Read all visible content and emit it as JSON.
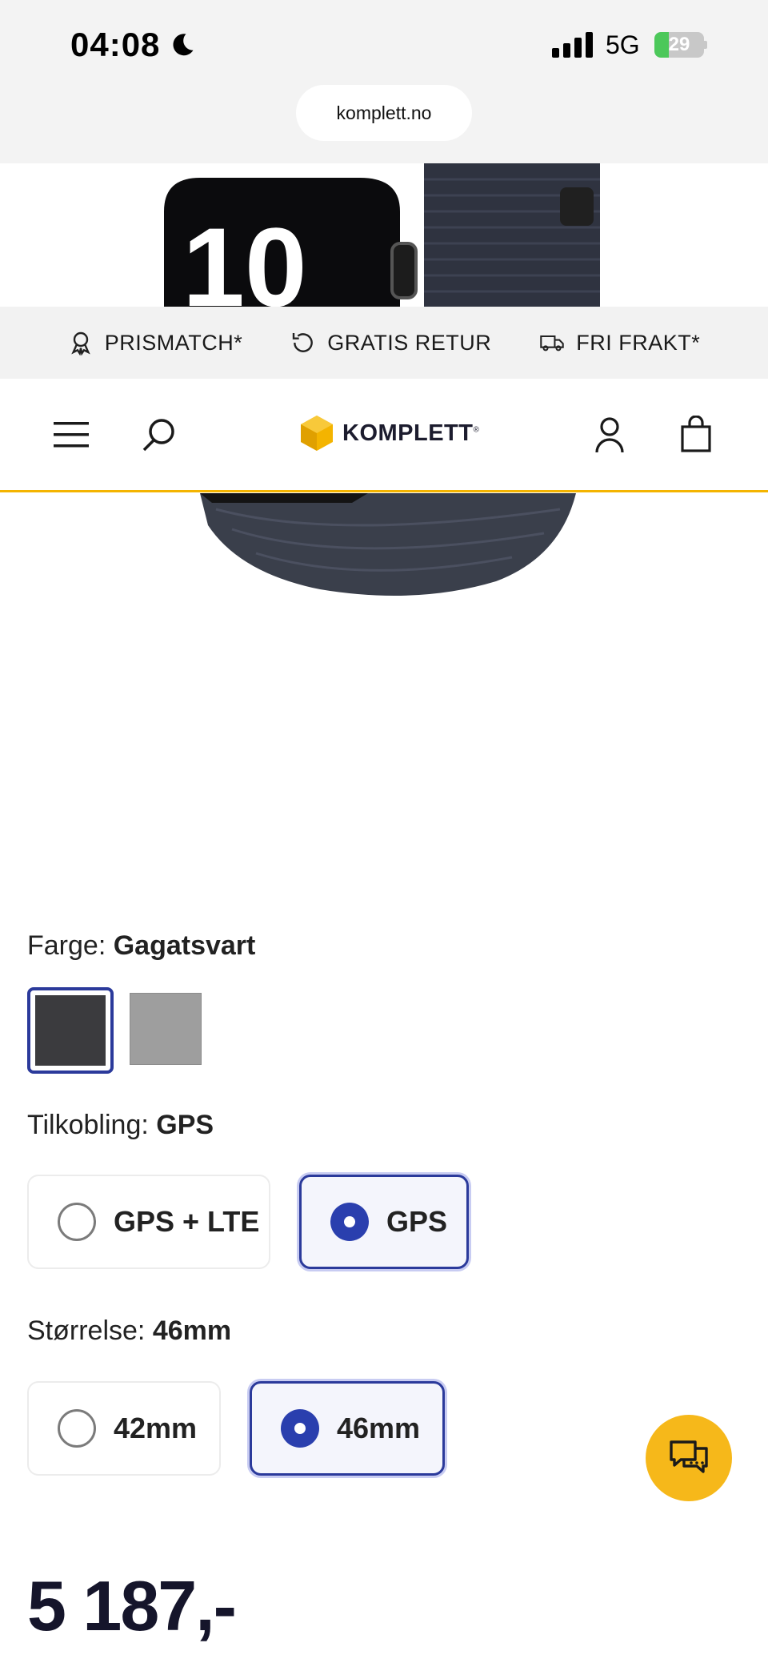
{
  "status_bar": {
    "time": "04:08",
    "network": "5G",
    "battery": "29",
    "battery_level": 0.29,
    "url": "komplett.no"
  },
  "usp_bar": {
    "items": [
      {
        "label": "PRISMATCH*",
        "icon": "award-icon"
      },
      {
        "label": "GRATIS RETUR",
        "icon": "return-icon"
      },
      {
        "label": "FRI FRAKT*",
        "icon": "truck-icon"
      }
    ]
  },
  "header": {
    "logo_text": "KOMPLETT",
    "logo_mark": "®",
    "icons": [
      "menu-icon",
      "search-icon",
      "account-icon",
      "cart-icon"
    ]
  },
  "product_image": {
    "watch_face_text": "10"
  },
  "color": {
    "label": "Farge: ",
    "value": "Gagatsvart",
    "swatches": [
      {
        "color": "#3b3b3e",
        "selected": true
      },
      {
        "color": "#9e9e9e",
        "selected": false
      }
    ]
  },
  "connectivity": {
    "label": "Tilkobling: ",
    "value": "GPS",
    "options": [
      {
        "label": "GPS + LTE",
        "selected": false
      },
      {
        "label": "GPS",
        "selected": true
      }
    ]
  },
  "size": {
    "label": "Størrelse: ",
    "value": "46mm",
    "options": [
      {
        "label": "42mm",
        "selected": false
      },
      {
        "label": "46mm",
        "selected": true
      }
    ]
  },
  "price": "5 187,-",
  "colors": {
    "accent": "#2b3a9b",
    "brand_yellow": "#f4b400",
    "chat_button": "#f6b81a"
  }
}
